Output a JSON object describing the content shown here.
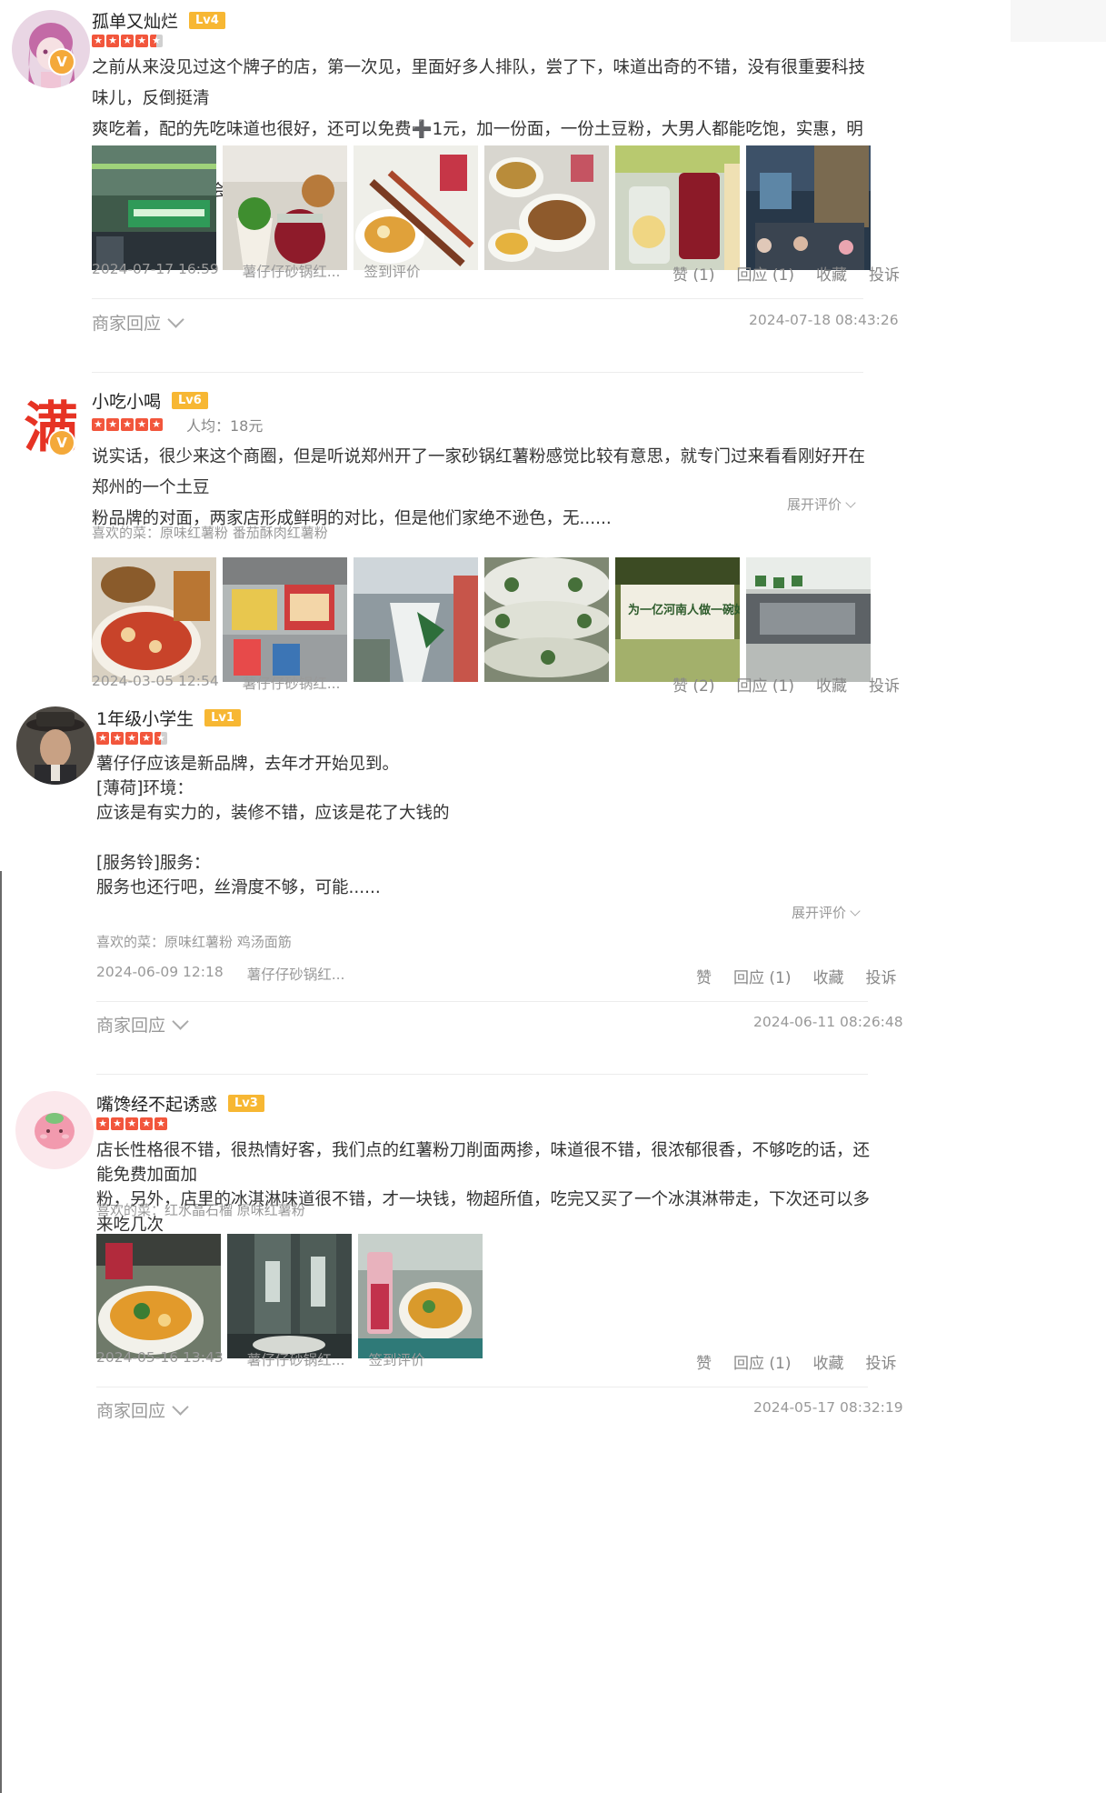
{
  "reviews": [
    {
      "username": "孤单又灿烂",
      "level": "Lv4",
      "verified_badge": "V",
      "text": "之前从来没见过这个牌子的店，第一次见，里面好多人排队，尝了下，味道出奇的不错，没有很重要科技味儿，反倒挺清\n爽吃着，配的先吃味道也很好，还可以免费➕1元，加一份面，一份土豆粉，大男人都能吃饱，实惠，明档厨房，干净，\n总之有机会了还会去第二次呢",
      "rating": 4.5,
      "date": "2024-07-17 16:59",
      "shop": "薯仔仔砂锅红...",
      "tag": "签到评价",
      "actions": {
        "like": "赞 (1)",
        "reply": "回应 (1)",
        "fav": "收藏",
        "report": "投诉"
      },
      "merchant_reply": "商家回应",
      "merchant_reply_time": "2024-07-18 08:43:26"
    },
    {
      "username": "小吃小喝",
      "level": "Lv6",
      "verified_badge": "V",
      "avatar_char": "满",
      "rating": 5,
      "per_capita": "人均：18元",
      "text": "说实话，很少来这个商圈，但是听说郑州开了一家砂锅红薯粉感觉比较有意思，就专门过来看看刚好开在郑州的一个土豆\n粉品牌的对面，两家店形成鲜明的对比，但是他们家绝不逊色，无......",
      "expand": "展开评价",
      "likes": "喜欢的菜：原味红薯粉 番茄酥肉红薯粉",
      "photo_banner_text": "为一亿河南人做一碗好粉",
      "date": "2024-03-05 12:54",
      "shop": "薯仔仔砂锅红...",
      "actions": {
        "like": "赞 (2)",
        "reply": "回应 (1)",
        "fav": "收藏",
        "report": "投诉"
      }
    },
    {
      "username": "1年级小学生",
      "level": "Lv1",
      "rating": 4.5,
      "text": "薯仔仔应该是新品牌，去年才开始见到。\n[薄荷]环境：\n应该是有实力的，装修不错，应该是花了大钱的\n\n[服务铃]服务：\n服务也还行吧，丝滑度不够，可能......",
      "expand": "展开评价",
      "likes": "喜欢的菜：原味红薯粉 鸡汤面筋",
      "date": "2024-06-09 12:18",
      "shop": "薯仔仔砂锅红...",
      "actions": {
        "like": "赞",
        "reply": "回应 (1)",
        "fav": "收藏",
        "report": "投诉"
      },
      "merchant_reply": "商家回应",
      "merchant_reply_time": "2024-06-11 08:26:48"
    },
    {
      "username": "嘴馋经不起诱惑",
      "level": "Lv3",
      "rating": 5,
      "text": "店长性格很不错，很热情好客，我们点的红薯粉刀削面两掺，味道很不错，很浓郁很香，不够吃的话，还能免费加面加\n粉，另外，店里的冰淇淋味道很不错，才一块钱，物超所值，吃完又买了一个冰淇淋带走，下次还可以多来吃几次",
      "likes": "喜欢的菜：红水晶石榴 原味红薯粉",
      "date": "2024-05-16 13:43",
      "shop": "薯仔仔砂锅红...",
      "tag": "签到评价",
      "actions": {
        "like": "赞",
        "reply": "回应 (1)",
        "fav": "收藏",
        "report": "投诉"
      },
      "merchant_reply": "商家回应",
      "merchant_reply_time": "2024-05-17 08:32:19"
    }
  ],
  "colors": {
    "star": "#f2563c",
    "level_badge": "#f7b733",
    "verified": "#f4a93a"
  }
}
